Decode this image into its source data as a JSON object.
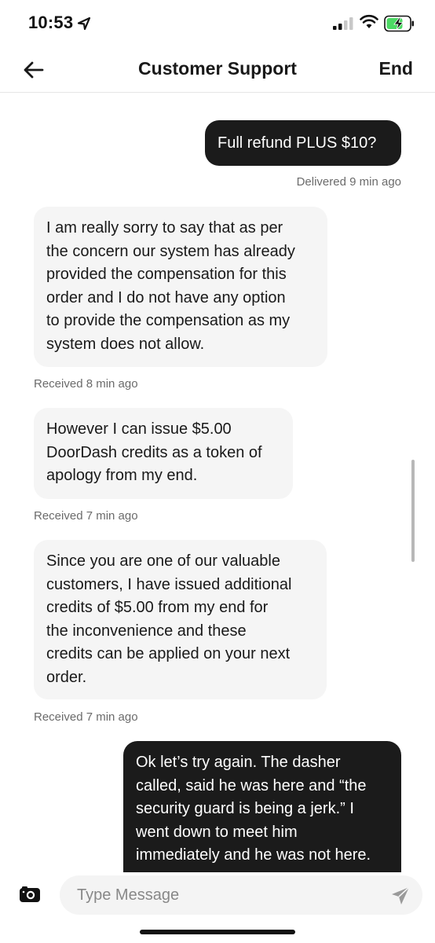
{
  "status_bar": {
    "time": "10:53",
    "icons": [
      "location-arrow-icon",
      "signal-icon",
      "wifi-icon",
      "battery-charging-icon"
    ],
    "battery_color": "#4cd964"
  },
  "header": {
    "back_icon": "arrow-left-icon",
    "title": "Customer Support",
    "end_label": "End"
  },
  "messages": [
    {
      "direction": "sent",
      "text": "Full refund PLUS $10?",
      "status": "Delivered 9 min ago"
    },
    {
      "direction": "received",
      "lines": [
        "I am really sorry to say that as per",
        "the concern our system has already",
        "provided the compensation for this",
        "order and I do not have any option",
        "to provide the compensation as my",
        "system does not allow."
      ],
      "status": "Received 8 min ago"
    },
    {
      "direction": "received",
      "lines": [
        "However I can issue $5.00",
        "DoorDash credits as a token of",
        "apology from my end."
      ],
      "status": "Received 7 min ago"
    },
    {
      "direction": "received",
      "lines": [
        "Since you are one of our valuable",
        "customers, I have issued additional",
        "credits of $5.00 from my end for",
        "the inconvenience and these",
        "credits can be applied on your next",
        "order."
      ],
      "status": "Received 7 min ago"
    },
    {
      "direction": "sent",
      "lines": [
        "Ok let’s try again. The dasher",
        "called, said he was here and “the",
        "security guard is being a jerk.” I",
        "went down to meet him",
        "immediately and he was not here."
      ]
    }
  ],
  "input": {
    "placeholder": "Type Message",
    "value": "",
    "camera_icon": "camera-icon",
    "send_icon": "send-icon"
  },
  "colors": {
    "sent_bubble": "#1b1b1b",
    "received_bubble": "#f5f5f5",
    "meta_text": "#6b6b6b"
  }
}
